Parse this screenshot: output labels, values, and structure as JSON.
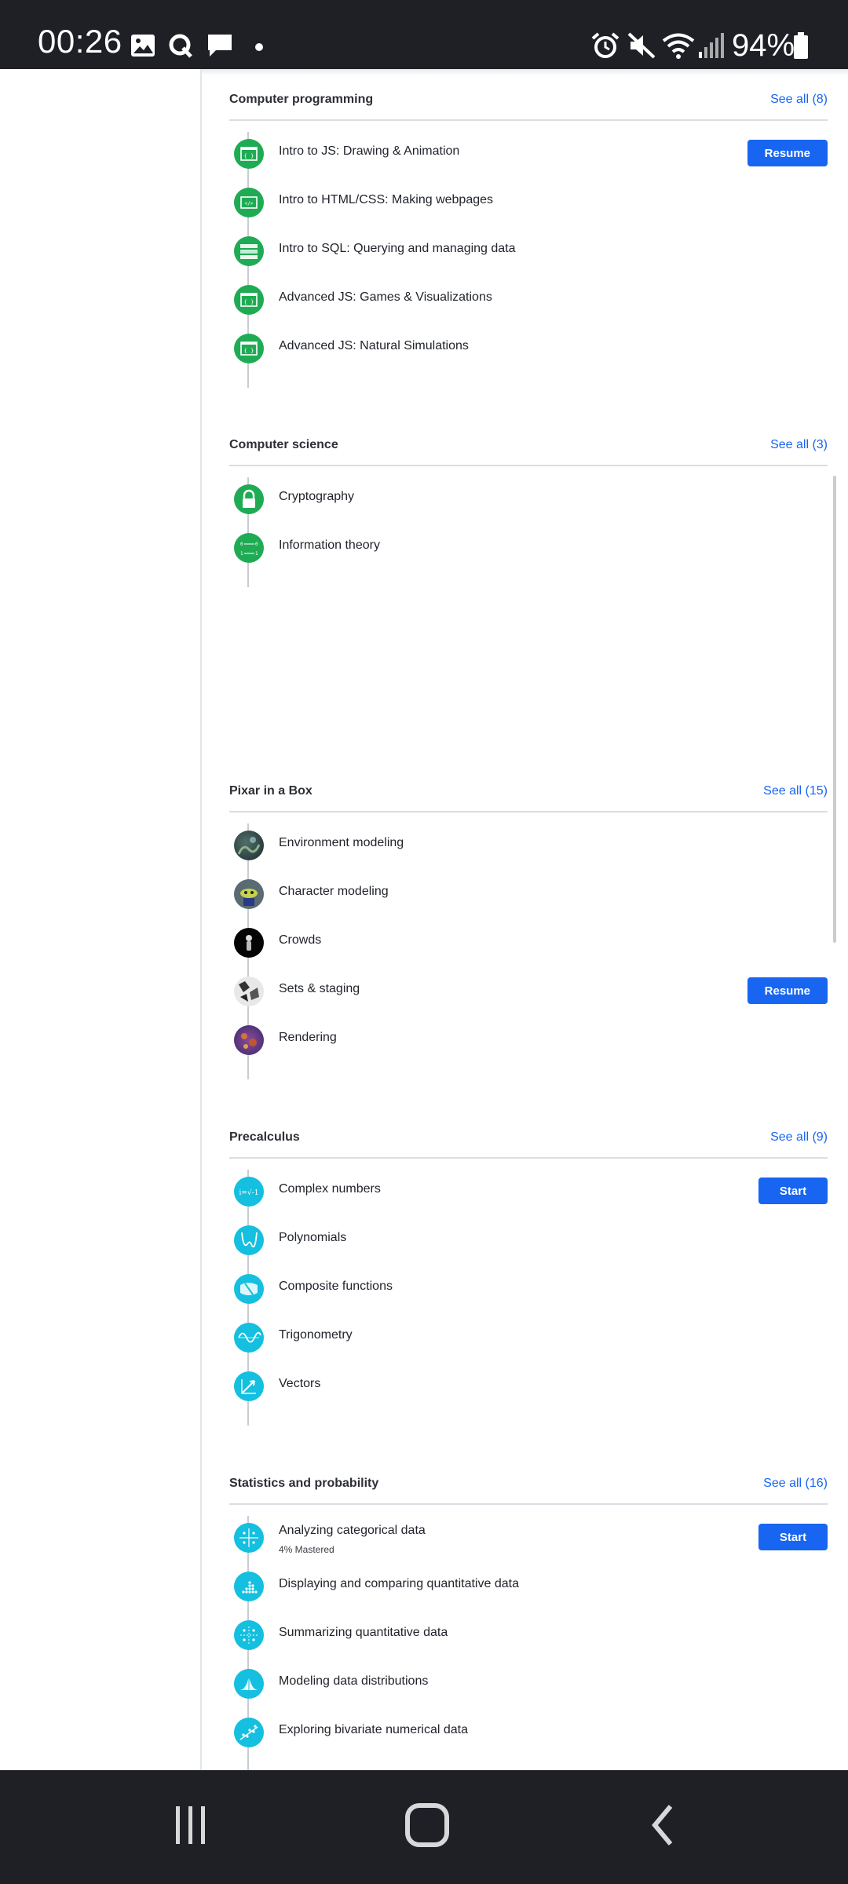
{
  "status_bar": {
    "time": "00:26",
    "battery": "94%",
    "icons": [
      "gallery-icon",
      "q-icon",
      "chat-icon",
      "dot-icon",
      "alarm-icon",
      "mute-icon",
      "wifi-icon",
      "signal-icon",
      "battery-icon"
    ]
  },
  "sections": [
    {
      "title": "Computer programming",
      "see_all": "See all (8)",
      "items": [
        {
          "label": "Intro to JS: Drawing & Animation",
          "icon": "code-window-icon",
          "button": "Resume"
        },
        {
          "label": "Intro to HTML/CSS: Making webpages",
          "icon": "html-tag-icon"
        },
        {
          "label": "Intro to SQL: Querying and managing data",
          "icon": "database-table-icon"
        },
        {
          "label": "Advanced JS: Games & Visualizations",
          "icon": "code-window-icon"
        },
        {
          "label": "Advanced JS: Natural Simulations",
          "icon": "code-window-icon"
        }
      ]
    },
    {
      "title": "Computer science",
      "see_all": "See all (3)",
      "items": [
        {
          "label": "Cryptography",
          "icon": "lock-icon"
        },
        {
          "label": "Information theory",
          "icon": "binary-channel-icon"
        }
      ]
    },
    {
      "title": "Pixar in a Box",
      "see_all": "See all (15)",
      "items": [
        {
          "label": "Environment modeling",
          "icon": "environment-thumbnail"
        },
        {
          "label": "Character modeling",
          "icon": "character-thumbnail"
        },
        {
          "label": "Crowds",
          "icon": "crowds-thumbnail"
        },
        {
          "label": "Sets & staging",
          "icon": "sets-thumbnail",
          "button": "Resume"
        },
        {
          "label": "Rendering",
          "icon": "rendering-thumbnail"
        }
      ]
    },
    {
      "title": "Precalculus",
      "see_all": "See all (9)",
      "items": [
        {
          "label": "Complex numbers",
          "icon": "imaginary-unit-icon",
          "button": "Start"
        },
        {
          "label": "Polynomials",
          "icon": "polynomial-graph-icon"
        },
        {
          "label": "Composite functions",
          "icon": "composite-function-icon"
        },
        {
          "label": "Trigonometry",
          "icon": "sine-wave-icon"
        },
        {
          "label": "Vectors",
          "icon": "vector-arrow-icon"
        }
      ]
    },
    {
      "title": "Statistics and probability",
      "see_all": "See all (16)",
      "items": [
        {
          "label": "Analyzing categorical data",
          "sub": "4% Mastered",
          "icon": "categorical-grid-icon",
          "button": "Start"
        },
        {
          "label": "Displaying and comparing quantitative data",
          "icon": "dot-plot-icon"
        },
        {
          "label": "Summarizing quantitative data",
          "icon": "summary-stats-icon"
        },
        {
          "label": "Modeling data distributions",
          "icon": "distribution-curve-icon"
        },
        {
          "label": "Exploring bivariate numerical data",
          "icon": "scatter-trend-icon"
        }
      ]
    }
  ],
  "colors": {
    "accent": "#1865f2",
    "computing_green": "#1fab54",
    "math_teal": "#14bfdf"
  }
}
